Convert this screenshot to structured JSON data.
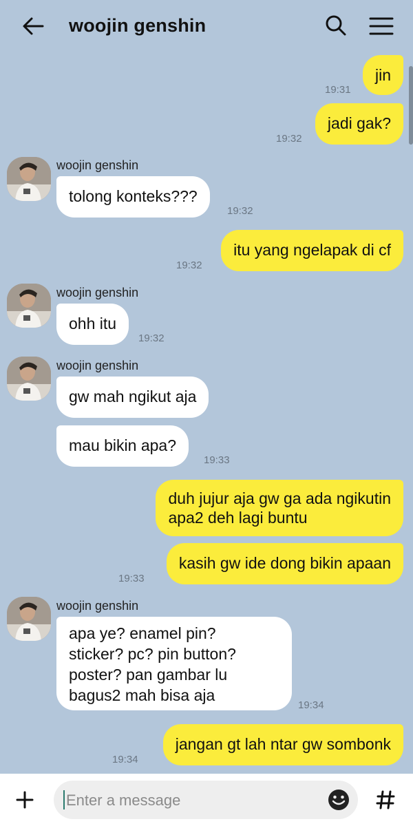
{
  "header": {
    "title": "woojin genshin",
    "back_icon": "arrow-left-icon",
    "search_icon": "search-icon",
    "menu_icon": "hamburger-menu-icon"
  },
  "messages": [
    {
      "from": "me",
      "text": "jin",
      "time": "19:31"
    },
    {
      "from": "me",
      "text": "jadi gak?",
      "time": "19:32"
    },
    {
      "from": "them",
      "sender": "woojin genshin",
      "text": "tolong konteks???",
      "time": "19:32"
    },
    {
      "from": "me",
      "text": "itu yang ngelapak di cf",
      "time": "19:32"
    },
    {
      "from": "them",
      "sender": "woojin genshin",
      "text": "ohh itu",
      "time": "19:32"
    },
    {
      "from": "them",
      "sender": "woojin genshin",
      "text": "gw mah ngikut aja",
      "time": ""
    },
    {
      "from": "them",
      "text": "mau bikin apa?",
      "time": "19:33"
    },
    {
      "from": "me",
      "text": "duh jujur aja gw ga ada ngikutin\napa2 deh lagi buntu",
      "time": ""
    },
    {
      "from": "me",
      "text": "kasih gw ide dong bikin apaan",
      "time": "19:33"
    },
    {
      "from": "them",
      "sender": "woojin genshin",
      "text": "apa ye? enamel pin?\nsticker? pc? pin button?\nposter? pan gambar lu\nbagus2 mah bisa aja",
      "time": "19:34"
    },
    {
      "from": "me",
      "text": "jangan gt lah ntar gw sombonk",
      "time": "19:34"
    }
  ],
  "composer": {
    "placeholder": "Enter a message",
    "add_icon": "plus-icon",
    "emoji_icon": "smiley-icon",
    "hashtag_icon": "hashtag-icon"
  },
  "colors": {
    "background": "#b3c6da",
    "my_bubble": "#fbec3c",
    "their_bubble": "#ffffff"
  }
}
